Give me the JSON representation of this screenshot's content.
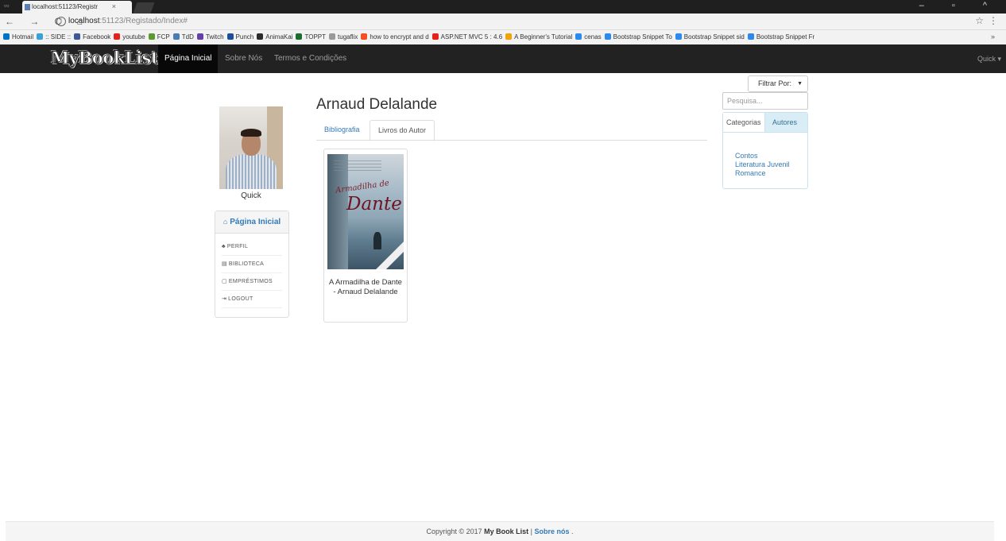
{
  "browser": {
    "tab_title": "localhost:51123/Registr",
    "tab_close": "×",
    "url_host": "localhost",
    "url_path": ":51123/Registado/Index#",
    "nav_buttons": "← → C ⌂",
    "window_controls": "– ▫ ^",
    "star": "☆",
    "menu": "⋮",
    "more": "»",
    "bookmarks": [
      {
        "label": "Hotmail",
        "color": "#0072c6"
      },
      {
        "label": ":: SIDE ::",
        "color": "#3aa0d8"
      },
      {
        "label": "Facebook",
        "color": "#3b5998"
      },
      {
        "label": "youtube",
        "color": "#e62117"
      },
      {
        "label": "FCP",
        "color": "#5a9a2f"
      },
      {
        "label": "TdD",
        "color": "#4a7bb5"
      },
      {
        "label": "Twitch",
        "color": "#6441a4"
      },
      {
        "label": "Punch",
        "color": "#1d4e9e"
      },
      {
        "label": "AnimaKai",
        "color": "#2b2b2b"
      },
      {
        "label": "TOPPT",
        "color": "#1d6e2e"
      },
      {
        "label": "tugaflix",
        "color": "#999999"
      },
      {
        "label": "how to encrypt and d",
        "color": "#f25022"
      },
      {
        "label": "ASP.NET MVC 5 : 4.6",
        "color": "#e62117"
      },
      {
        "label": "A Beginner's Tutorial",
        "color": "#f0a30a"
      },
      {
        "label": "cenas",
        "color": "#2d89ef"
      },
      {
        "label": "Bootstrap Snippet To",
        "color": "#2d89ef"
      },
      {
        "label": "Bootstrap Snippet sid",
        "color": "#2d89ef"
      },
      {
        "label": "Bootstrap Snippet Fr",
        "color": "#2d89ef"
      }
    ]
  },
  "navbar": {
    "brand": "MyBookList",
    "items": [
      "Página Inicial",
      "Sobre Nós",
      "Termos e Condições"
    ],
    "user": "Quick ▾"
  },
  "profile": {
    "name": "Quick",
    "menu_title": "Página Inicial",
    "menu_items": [
      {
        "icon": "♣",
        "label": "PERFIL"
      },
      {
        "icon": "▤",
        "label": "BIBLIOTECA"
      },
      {
        "icon": "▢",
        "label": "EMPRÉSTIMOS"
      },
      {
        "icon": "⇥",
        "label": "LOGOUT"
      }
    ]
  },
  "author": {
    "name": "Arnaud Delalande",
    "tabs": [
      "Bibliografia",
      "Livros do Autor"
    ],
    "books": [
      {
        "title": "A Armadilha de Dante - Arnaud Delalande",
        "cover_title_small": "Armadilha de",
        "cover_title_big": "Dante"
      }
    ]
  },
  "sidebar_right": {
    "filter_label": "Filtrar Por:",
    "search_placeholder": "Pesquisa...",
    "tabs": [
      "Categorias",
      "Autores"
    ],
    "categories": [
      "Contos",
      "Literatura Juvenil",
      "Romance"
    ]
  },
  "footer": {
    "copyright": "Copyright © 2017 ",
    "brand": "My Book List",
    "sep": " | ",
    "link": "Sobre nós",
    "end": " ."
  }
}
